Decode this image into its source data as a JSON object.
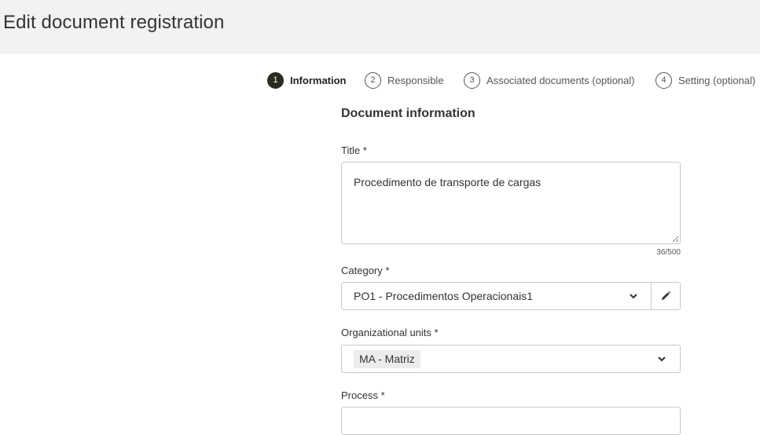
{
  "header": {
    "title": "Edit document registration"
  },
  "stepper": {
    "steps": [
      {
        "number": "1",
        "label": "Information"
      },
      {
        "number": "2",
        "label": "Responsible"
      },
      {
        "number": "3",
        "label": "Associated documents (optional)"
      },
      {
        "number": "4",
        "label": "Setting (optional)"
      }
    ],
    "active_step": 1
  },
  "form": {
    "section_title": "Document information",
    "title_field": {
      "label": "Title *",
      "value": "Procedimento de transporte de cargas",
      "counter": "36/500"
    },
    "category_field": {
      "label": "Category *",
      "value": "PO1 - Procedimentos Operacionais1"
    },
    "org_units_field": {
      "label": "Organizational units *",
      "chips": [
        "MA - Matriz"
      ]
    },
    "process_field": {
      "label": "Process *"
    }
  },
  "colors": {
    "header_bg": "#f2f2f2",
    "active_step": "#2b2b1f",
    "border": "#c8c8c8"
  }
}
